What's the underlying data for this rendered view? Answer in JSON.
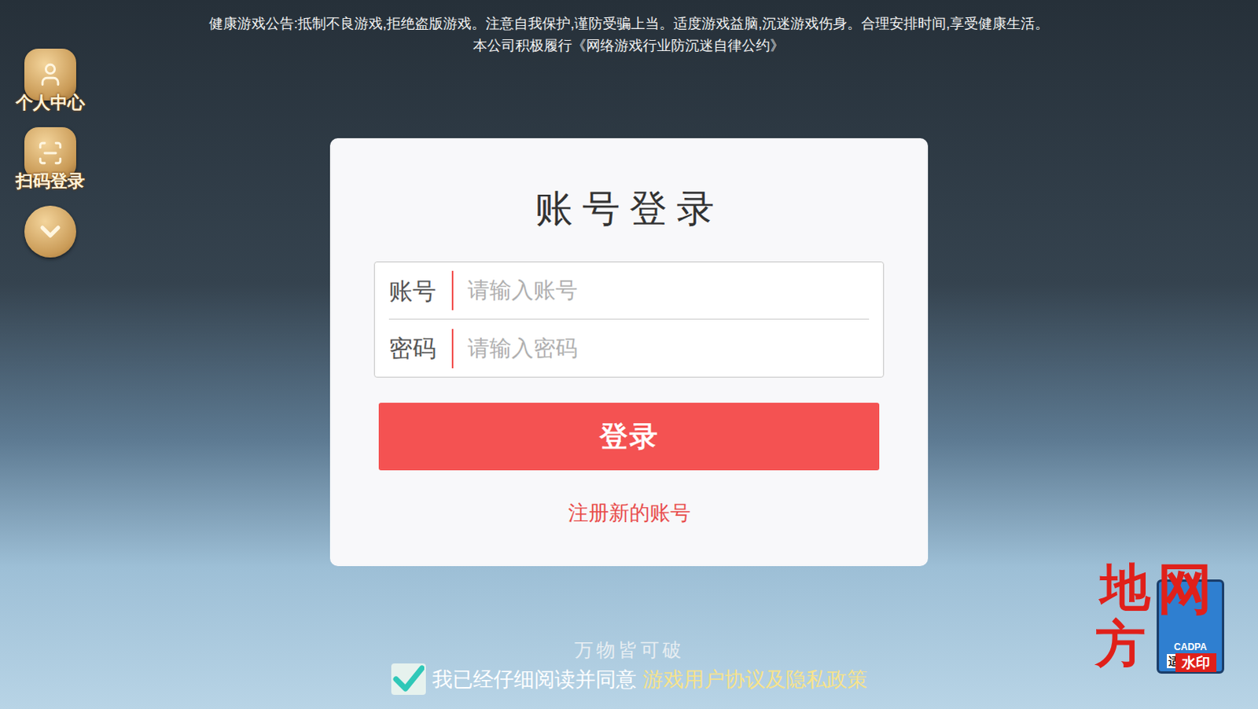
{
  "notice": [
    "健康游戏公告:抵制不良游戏,拒绝盗版游戏。注意自我保护,谨防受骗上当。适度游戏益脑,沉迷游戏伤身。合理安排时间,享受健康生活。",
    "本公司积极履行《网络游戏行业防沉迷自律公约》"
  ],
  "side_menu": [
    {
      "label": "个人中心",
      "kind": "user"
    },
    {
      "label": "扫码登录",
      "kind": "scan"
    },
    {
      "label": "",
      "kind": "collapse"
    }
  ],
  "login_card": {
    "title": "账号登录",
    "fields": [
      {
        "label": "账号",
        "placeholder": "请输入账号",
        "kind": "text"
      },
      {
        "label": "密码",
        "placeholder": "请输入密码",
        "kind": "password"
      }
    ],
    "submit": "登录",
    "register_link": "注册新的账号"
  },
  "slogan": "万物皆可破",
  "agreement": {
    "checked": true,
    "text": "我已经仔细阅读并同意",
    "link": "游戏用户协议及隐私政策"
  },
  "age_badge": {
    "label": "适龄提示",
    "code": "CADPA"
  },
  "watermark": {
    "glyphs": [
      "地",
      "方",
      "网"
    ],
    "label": "水印"
  }
}
